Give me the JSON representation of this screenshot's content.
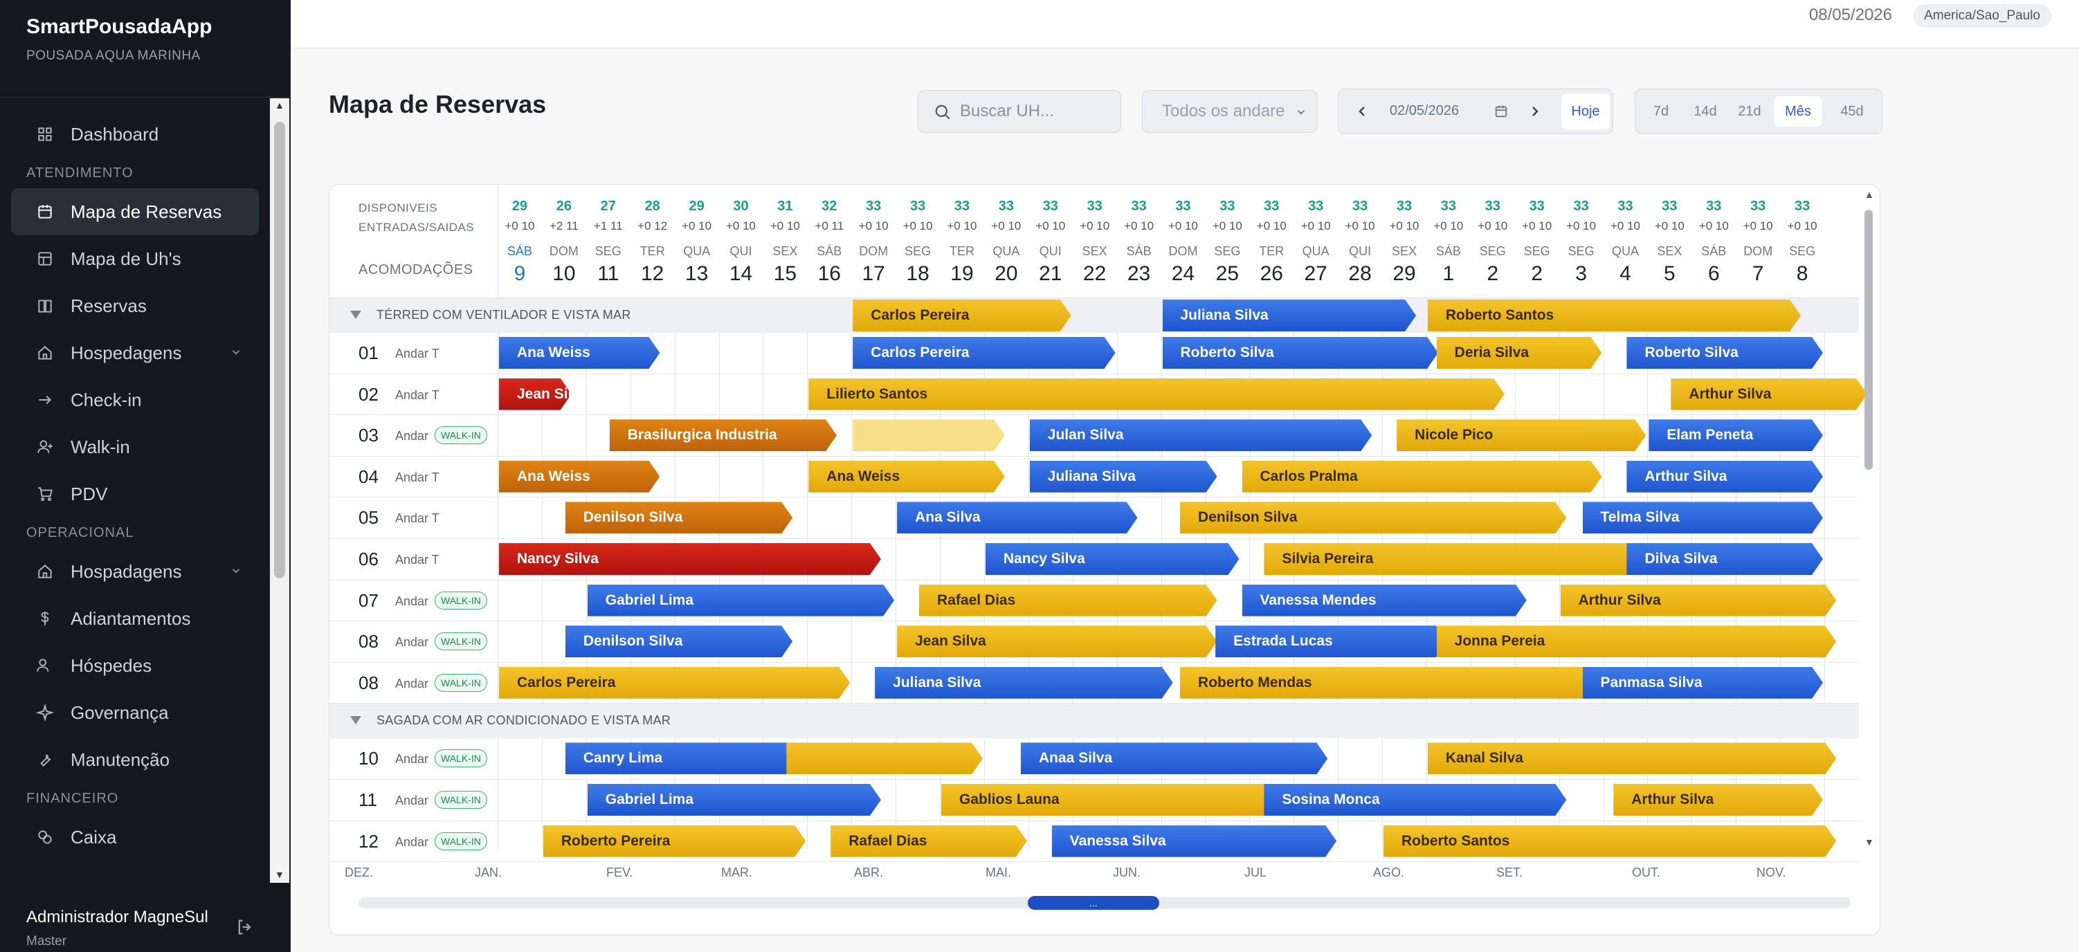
{
  "app": {
    "name": "SmartPousadaApp",
    "property": "POUSADA AQUA MARINHA"
  },
  "topbar": {
    "date": "08/05/2026",
    "timezone": "America/Sao_Paulo"
  },
  "sidebar": {
    "sections": [
      {
        "items": [
          {
            "label": "Dashboard",
            "icon": "grid-icon"
          }
        ]
      },
      {
        "title": "ATENDIMENTO",
        "items": [
          {
            "label": "Mapa de Reservas",
            "icon": "calendar-icon",
            "active": true
          },
          {
            "label": "Mapa de Uh's",
            "icon": "layout-icon"
          },
          {
            "label": "Reservas",
            "icon": "book-icon"
          },
          {
            "label": "Hospedagens",
            "icon": "home-icon",
            "chevron": true
          },
          {
            "label": "Check-in",
            "icon": "arrow-right-icon"
          },
          {
            "label": "Walk-in",
            "icon": "user-plus-icon"
          },
          {
            "label": "PDV",
            "icon": "cart-icon"
          }
        ]
      },
      {
        "title": "OPERACIONAL",
        "items": [
          {
            "label": "Hospadagens",
            "icon": "home-icon",
            "chevron": true
          },
          {
            "label": "Adiantamentos",
            "icon": "dollar-icon"
          },
          {
            "label": "Hóspedes",
            "icon": "users-icon"
          },
          {
            "label": "Governança",
            "icon": "sparkle-icon"
          },
          {
            "label": "Manutenção",
            "icon": "wrench-icon"
          }
        ]
      },
      {
        "title": "FINANCEIRO",
        "items": [
          {
            "label": "Caixa",
            "icon": "coins-icon"
          }
        ]
      }
    ],
    "user": {
      "name": "Administrador MagneSul",
      "role": "Master"
    }
  },
  "page": {
    "title": "Mapa de Reservas",
    "search_placeholder": "Buscar UH...",
    "floor_select": "Todos os andare",
    "date_value": "02/05/2026",
    "today_label": "Hoje",
    "ranges": [
      "7d",
      "14d",
      "21d",
      "Mês",
      "45d"
    ],
    "active_range": "Mês"
  },
  "board": {
    "header_labels": {
      "available": "DISPONIVEIS",
      "inout": "ENTRADAS/SAIDAS",
      "rooms": "ACOMODAÇÕES"
    },
    "days": [
      {
        "dow": "SÁB",
        "num": "9",
        "avail": "29",
        "io": "+0 10",
        "today": true
      },
      {
        "dow": "DOM",
        "num": "10",
        "avail": "26",
        "io": "+2 11"
      },
      {
        "dow": "SEG",
        "num": "11",
        "avail": "27",
        "io": "+1 11"
      },
      {
        "dow": "TER",
        "num": "12",
        "avail": "28",
        "io": "+0 12"
      },
      {
        "dow": "QUA",
        "num": "13",
        "avail": "29",
        "io": "+0 10"
      },
      {
        "dow": "QUI",
        "num": "14",
        "avail": "30",
        "io": "+0 10"
      },
      {
        "dow": "SEX",
        "num": "15",
        "avail": "31",
        "io": "+0 10"
      },
      {
        "dow": "SÁB",
        "num": "16",
        "avail": "32",
        "io": "+0 11"
      },
      {
        "dow": "DOM",
        "num": "17",
        "avail": "33",
        "io": "+0 10"
      },
      {
        "dow": "SEG",
        "num": "18",
        "avail": "33",
        "io": "+0 10"
      },
      {
        "dow": "TER",
        "num": "19",
        "avail": "33",
        "io": "+0 10"
      },
      {
        "dow": "QUA",
        "num": "20",
        "avail": "33",
        "io": "+0 10"
      },
      {
        "dow": "QUI",
        "num": "21",
        "avail": "33",
        "io": "+0 10"
      },
      {
        "dow": "SEX",
        "num": "22",
        "avail": "33",
        "io": "+0 10"
      },
      {
        "dow": "SÁB",
        "num": "23",
        "avail": "33",
        "io": "+0 10"
      },
      {
        "dow": "DOM",
        "num": "24",
        "avail": "33",
        "io": "+0 10"
      },
      {
        "dow": "SEG",
        "num": "25",
        "avail": "33",
        "io": "+0 10"
      },
      {
        "dow": "TER",
        "num": "26",
        "avail": "33",
        "io": "+0 10"
      },
      {
        "dow": "QUA",
        "num": "27",
        "avail": "33",
        "io": "+0 10"
      },
      {
        "dow": "QUI",
        "num": "28",
        "avail": "33",
        "io": "+0 10"
      },
      {
        "dow": "SEX",
        "num": "29",
        "avail": "33",
        "io": "+0 10"
      },
      {
        "dow": "SÁB",
        "num": "1",
        "avail": "33",
        "io": "+0 10"
      },
      {
        "dow": "SEG",
        "num": "2",
        "avail": "33",
        "io": "+0 10"
      },
      {
        "dow": "SEG",
        "num": "2",
        "avail": "33",
        "io": "+0 10"
      },
      {
        "dow": "SEG",
        "num": "3",
        "avail": "33",
        "io": "+0 10"
      },
      {
        "dow": "QUA",
        "num": "4",
        "avail": "33",
        "io": "+0 10"
      },
      {
        "dow": "SEX",
        "num": "5",
        "avail": "33",
        "io": "+0 10"
      },
      {
        "dow": "SÁB",
        "num": "6",
        "avail": "33",
        "io": "+0 10"
      },
      {
        "dow": "DOM",
        "num": "7",
        "avail": "33",
        "io": "+0 10"
      },
      {
        "dow": "SEG",
        "num": "8",
        "avail": "33",
        "io": "+0 10"
      }
    ],
    "groups": [
      {
        "label": "TÉRRED COM VENTILADOR E VISTA MAR",
        "header_bars": [
          {
            "guest": "Carlos Pereira",
            "color": "yellow",
            "start": 8,
            "end": 13
          },
          {
            "guest": "Juliana Silva",
            "color": "blue",
            "start": 15,
            "end": 20.8
          },
          {
            "guest": "Roberto Santos",
            "color": "yellow",
            "start": 21,
            "end": 29.5
          }
        ],
        "rooms": [
          {
            "no": "01",
            "floor": "Andar T",
            "bars": [
              {
                "guest": "Ana Weiss",
                "color": "blue",
                "start": 0,
                "end": 3.7
              },
              {
                "guest": "Carlos Pereira",
                "color": "blue",
                "start": 8,
                "end": 14
              },
              {
                "guest": "Roberto Silva",
                "color": "blue",
                "start": 15,
                "end": 21.3
              },
              {
                "guest": "Deria Silva",
                "color": "yellow",
                "start": 21.2,
                "end": 25
              },
              {
                "guest": "Roberto Silva",
                "color": "blue",
                "start": 25.5,
                "end": 30
              }
            ]
          },
          {
            "no": "02",
            "floor": "Andar T",
            "bars": [
              {
                "guest": "Jean Silva",
                "color": "red",
                "start": 0,
                "end": 1.7
              },
              {
                "guest": "Lilierto Santos",
                "color": "yellow",
                "start": 7,
                "end": 22.8
              },
              {
                "guest": "Arthur Silva",
                "color": "yellow",
                "start": 26.5,
                "end": 31
              }
            ]
          },
          {
            "no": "03",
            "floor": "Andar",
            "walkin": "WALK-IN",
            "bars": [
              {
                "guest": "Brasilurgica Industria",
                "color": "orange",
                "start": 2.5,
                "end": 7.7
              },
              {
                "guest": "",
                "color": "pale",
                "start": 8,
                "end": 11.5
              },
              {
                "guest": "Julan Silva",
                "color": "blue",
                "start": 12,
                "end": 19.8
              },
              {
                "guest": "Nicole Pico",
                "color": "yellow",
                "start": 20.3,
                "end": 26
              },
              {
                "guest": "Elam Peneta",
                "color": "blue",
                "start": 26,
                "end": 30
              }
            ]
          },
          {
            "no": "04",
            "floor": "Andar T",
            "bars": [
              {
                "guest": "Ana Weiss",
                "color": "orange",
                "start": 0,
                "end": 3.7
              },
              {
                "guest": "Ana Weiss",
                "color": "yellow",
                "start": 7,
                "end": 11.5
              },
              {
                "guest": "Juliana Silva",
                "color": "blue",
                "start": 12,
                "end": 16.3
              },
              {
                "guest": "Carlos Pralma",
                "color": "yellow",
                "start": 16.8,
                "end": 25
              },
              {
                "guest": "Arthur Silva",
                "color": "blue",
                "start": 25.5,
                "end": 30
              }
            ]
          },
          {
            "no": "05",
            "floor": "Andar T",
            "bars": [
              {
                "guest": "Denilson Silva",
                "color": "orange",
                "start": 1.5,
                "end": 6.7
              },
              {
                "guest": "Ana Silva",
                "color": "blue",
                "start": 9,
                "end": 14.5
              },
              {
                "guest": "Denilson Silva",
                "color": "yellow",
                "start": 15.4,
                "end": 24.2
              },
              {
                "guest": "Telma Silva",
                "color": "blue",
                "start": 24.5,
                "end": 30
              }
            ]
          },
          {
            "no": "06",
            "floor": "Andar T",
            "bars": [
              {
                "guest": "Nancy Silva",
                "color": "red",
                "start": 0,
                "end": 8.7
              },
              {
                "guest": "Nancy Silva",
                "color": "blue",
                "start": 11,
                "end": 16.8
              },
              {
                "guest": "Silvia Pereira",
                "color": "yellow",
                "start": 17.3,
                "end": 26
              },
              {
                "guest": "Dilva Silva",
                "color": "blue",
                "start": 25.5,
                "end": 30
              }
            ]
          },
          {
            "no": "07",
            "floor": "Andar",
            "walkin": "WALK-IN",
            "bars": [
              {
                "guest": "Gabriel Lima",
                "color": "blue",
                "start": 2,
                "end": 9
              },
              {
                "guest": "Rafael Dias",
                "color": "yellow",
                "start": 9.5,
                "end": 16.3
              },
              {
                "guest": "Vanessa Mendes",
                "color": "blue",
                "start": 16.8,
                "end": 23.3
              },
              {
                "guest": "Arthur Silva",
                "color": "yellow",
                "start": 24,
                "end": 30.3
              }
            ]
          },
          {
            "no": "08",
            "floor": "Andar",
            "walkin": "WALK-IN",
            "bars": [
              {
                "guest": "Denilson Silva",
                "color": "blue",
                "start": 1.5,
                "end": 6.7
              },
              {
                "guest": "Jean Silva",
                "color": "yellow",
                "start": 9,
                "end": 16.3
              },
              {
                "guest": "Estrada Lucas",
                "color": "blue",
                "start": 16.2,
                "end": 21.5
              },
              {
                "guest": "Jonna Pereia",
                "color": "yellow",
                "start": 21.2,
                "end": 30.3
              }
            ]
          },
          {
            "no": "08",
            "floor": "Andar",
            "walkin": "WALK-IN",
            "bars": [
              {
                "guest": "Carlos Pereira",
                "color": "yellow",
                "start": 0,
                "end": 8
              },
              {
                "guest": "Juliana Silva",
                "color": "blue",
                "start": 8.5,
                "end": 15.3
              },
              {
                "guest": "Roberto Mendas",
                "color": "yellow",
                "start": 15.4,
                "end": 25
              },
              {
                "guest": "Panmasa Silva",
                "color": "blue",
                "start": 24.5,
                "end": 30
              }
            ]
          }
        ]
      },
      {
        "label": "SAGADA COM AR CONDICIONADO E VISTA MAR",
        "rooms": [
          {
            "no": "10",
            "floor": "Andar",
            "walkin": "WALK-IN",
            "bars": [
              {
                "guest": "Canry Lima",
                "color": "blue",
                "start": 1.5,
                "end": 7
              },
              {
                "guest": "",
                "color": "yellow",
                "start": 6.5,
                "end": 11
              },
              {
                "guest": "Anaa Silva",
                "color": "blue",
                "start": 11.8,
                "end": 18.8
              },
              {
                "guest": "Kanal Silva",
                "color": "yellow",
                "start": 21,
                "end": 30.3
              }
            ]
          },
          {
            "no": "11",
            "floor": "Andar",
            "walkin": "WALK-IN",
            "bars": [
              {
                "guest": "Gabriel Lima",
                "color": "blue",
                "start": 2,
                "end": 8.7
              },
              {
                "guest": "Gablios Launa",
                "color": "yellow",
                "start": 10,
                "end": 17.8
              },
              {
                "guest": "Sosina Monca",
                "color": "blue",
                "start": 17.3,
                "end": 24.2
              },
              {
                "guest": "Arthur Silva",
                "color": "yellow",
                "start": 25.2,
                "end": 30
              }
            ]
          },
          {
            "no": "12",
            "floor": "Andar",
            "walkin": "WALK-IN",
            "bars": [
              {
                "guest": "Roberto Pereira",
                "color": "yellow",
                "start": 1,
                "end": 7
              },
              {
                "guest": "Rafael Dias",
                "color": "yellow",
                "start": 7.5,
                "end": 12
              },
              {
                "guest": "Vanessa Silva",
                "color": "blue",
                "start": 12.5,
                "end": 19
              },
              {
                "guest": "Roberto Santos",
                "color": "yellow",
                "start": 20,
                "end": 30.3
              }
            ]
          }
        ]
      }
    ],
    "months": [
      "DEZ.",
      "JAN.",
      "FEV.",
      "MAR.",
      "ABR.",
      "MAI.",
      "JUN.",
      "JUL",
      "AGO.",
      "SET.",
      "OUT.",
      "NOV."
    ],
    "scroll_handle": "..."
  }
}
